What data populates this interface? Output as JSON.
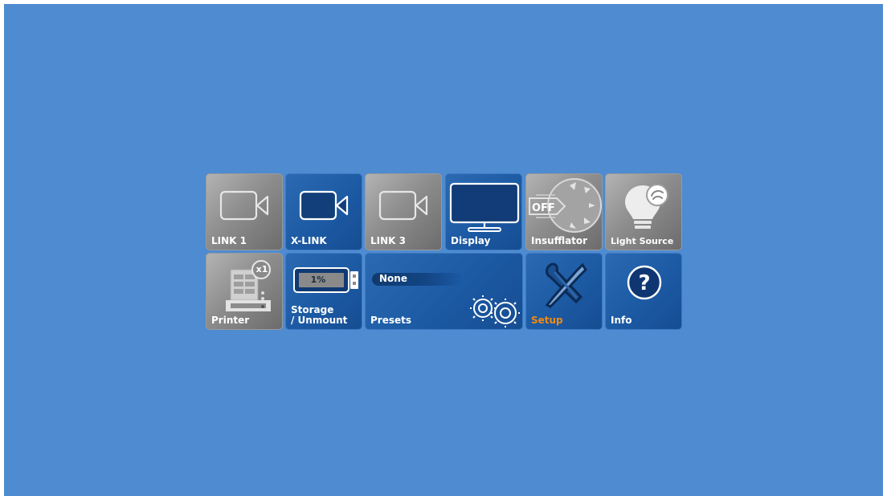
{
  "tiles": {
    "link1": {
      "label": "LINK 1",
      "icon": "camera-icon",
      "style": "gray"
    },
    "xlink": {
      "label": "X-LINK",
      "icon": "camera-icon",
      "style": "blue"
    },
    "link3": {
      "label": "LINK 3",
      "icon": "camera-icon",
      "style": "gray"
    },
    "display": {
      "label": "Display",
      "icon": "monitor-icon",
      "style": "blue"
    },
    "insufflator": {
      "label": "Insufflator",
      "icon": "insufflator-icon",
      "off_text": "OFF",
      "style": "gray"
    },
    "light_source": {
      "label": "Light Source",
      "icon": "light-bulb-icon",
      "style": "gray"
    },
    "printer": {
      "label": "Printer",
      "icon": "printer-icon",
      "badge": "x1",
      "style": "gray"
    },
    "storage": {
      "label": "Storage\n/ Unmount",
      "icon": "usb-drive-icon",
      "usage": "1%",
      "usage_fraction": 0.01,
      "style": "blue"
    },
    "presets": {
      "label": "Presets",
      "icon": "gears-icon",
      "selected": "None",
      "style": "blue"
    },
    "setup": {
      "label": "Setup",
      "icon": "tools-icon",
      "style": "blue",
      "label_color": "#f28a12"
    },
    "info": {
      "label": "Info",
      "icon": "question-icon",
      "style": "blue"
    }
  },
  "colors": {
    "background": "#4e8bd0",
    "tile_blue": "#1c5aa4",
    "tile_gray": "#8e8e8e",
    "accent_orange": "#f28a12"
  }
}
